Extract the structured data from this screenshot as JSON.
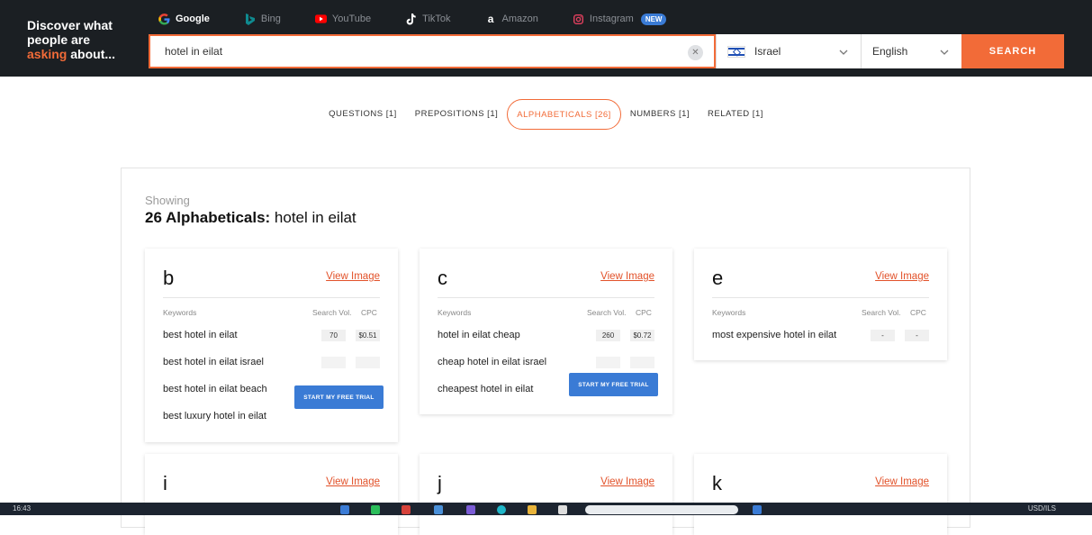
{
  "brand": {
    "line1": "Discover what",
    "line2": "people are",
    "accent": "asking",
    "line3_rest": " about..."
  },
  "engines": [
    {
      "label": "Google",
      "icon": "google-icon",
      "active": true
    },
    {
      "label": "Bing",
      "icon": "bing-icon",
      "active": false
    },
    {
      "label": "YouTube",
      "icon": "youtube-icon",
      "active": false
    },
    {
      "label": "TikTok",
      "icon": "tiktok-icon",
      "active": false
    },
    {
      "label": "Amazon",
      "icon": "amazon-icon",
      "active": false
    },
    {
      "label": "Instagram",
      "icon": "instagram-icon",
      "active": false,
      "badge": "NEW"
    }
  ],
  "search": {
    "value": "hotel in eilat",
    "country": "Israel",
    "language": "English",
    "button": "SEARCH"
  },
  "tabs": [
    {
      "label": "QUESTIONS [1]",
      "active": false
    },
    {
      "label": "PREPOSITIONS [1]",
      "active": false
    },
    {
      "label": "ALPHABETICALS [26]",
      "active": true
    },
    {
      "label": "NUMBERS [1]",
      "active": false
    },
    {
      "label": "RELATED [1]",
      "active": false
    }
  ],
  "results": {
    "showing": "Showing",
    "count_label": "26 Alphabeticals:",
    "query": " hotel in eilat"
  },
  "card_labels": {
    "view_image": "View Image",
    "keywords": "Keywords",
    "search_vol": "Search Vol.",
    "cpc": "CPC",
    "trial": "START MY FREE TRIAL"
  },
  "cards": [
    {
      "letter": "b",
      "keywords": [
        {
          "text": "best hotel in eilat",
          "vol": "70",
          "cpc": "$0.51"
        },
        {
          "text": "best hotel in eilat israel"
        },
        {
          "text": "best hotel in eilat beach"
        },
        {
          "text": "best luxury hotel in eilat"
        }
      ]
    },
    {
      "letter": "c",
      "keywords": [
        {
          "text": "hotel in eilat cheap",
          "vol": "260",
          "cpc": "$0.72"
        },
        {
          "text": "cheap hotel in eilat israel"
        },
        {
          "text": "cheapest hotel in eilat"
        }
      ]
    },
    {
      "letter": "e",
      "keywords": [
        {
          "text": "most expensive hotel in eilat",
          "vol": "-",
          "cpc": "-"
        }
      ]
    },
    {
      "letter": "i"
    },
    {
      "letter": "j"
    },
    {
      "letter": "k"
    }
  ],
  "taskbar": {
    "clock": "16:43",
    "currency": "USD/ILS"
  },
  "colors": {
    "accent": "#f26b38",
    "header_bg": "#1b1f23",
    "link": "#e2522a",
    "trial_button": "#3a7bd5"
  }
}
